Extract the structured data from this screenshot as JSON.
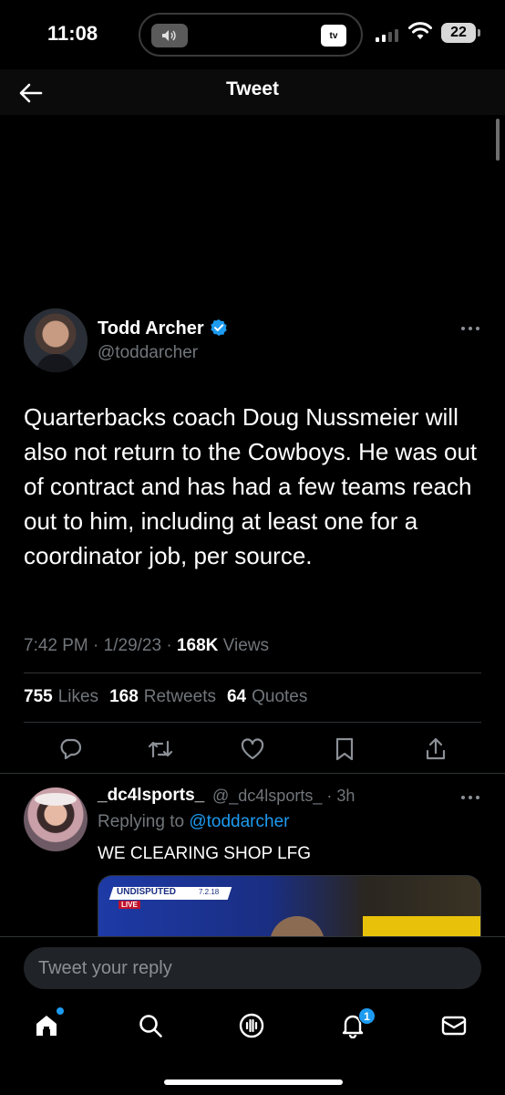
{
  "status_bar": {
    "time": "11:08",
    "now_playing_badge": "tv",
    "battery": "22"
  },
  "header": {
    "title": "Tweet"
  },
  "tweet": {
    "author_name": "Todd Archer",
    "author_handle": "@toddarcher",
    "text": "Quarterbacks coach Doug Nussmeier will also not return to the Cowboys. He was out of contract and has had a few teams reach out to him, including at least one for a coordinator job, per source.",
    "time": "7:42 PM",
    "date": "1/29/23",
    "views_count": "168K",
    "views_label": "Views",
    "likes_count": "755",
    "likes_label": "Likes",
    "retweets_count": "168",
    "retweets_label": "Retweets",
    "quotes_count": "64",
    "quotes_label": "Quotes"
  },
  "reply": {
    "author_name": "_dc4lsports_",
    "author_handle": "@_dc4lsports_",
    "age": "3h",
    "replying_prefix": "Replying to",
    "replying_handle": "@toddarcher",
    "text": "WE CLEARING SHOP LFG",
    "media_badge": "UNDISPUTED",
    "media_live": "LIVE",
    "media_date": "7.2.18"
  },
  "composer": {
    "placeholder": "Tweet your reply"
  },
  "tab_bar": {
    "notifications_badge": "1"
  },
  "colors": {
    "accent": "#1d9bf0",
    "background": "#000000",
    "secondary_text": "#71767b",
    "divider": "#2f3336"
  },
  "icons": {
    "back": "arrow-left-icon",
    "verified": "verified-badge-icon",
    "reply": "speech-bubble-icon",
    "retweet": "retweet-icon",
    "like": "heart-icon",
    "bookmark": "bookmark-icon",
    "share": "share-icon",
    "home": "home-icon",
    "search": "search-icon",
    "spaces": "spaces-icon",
    "notifications": "bell-icon",
    "messages": "mail-icon"
  }
}
